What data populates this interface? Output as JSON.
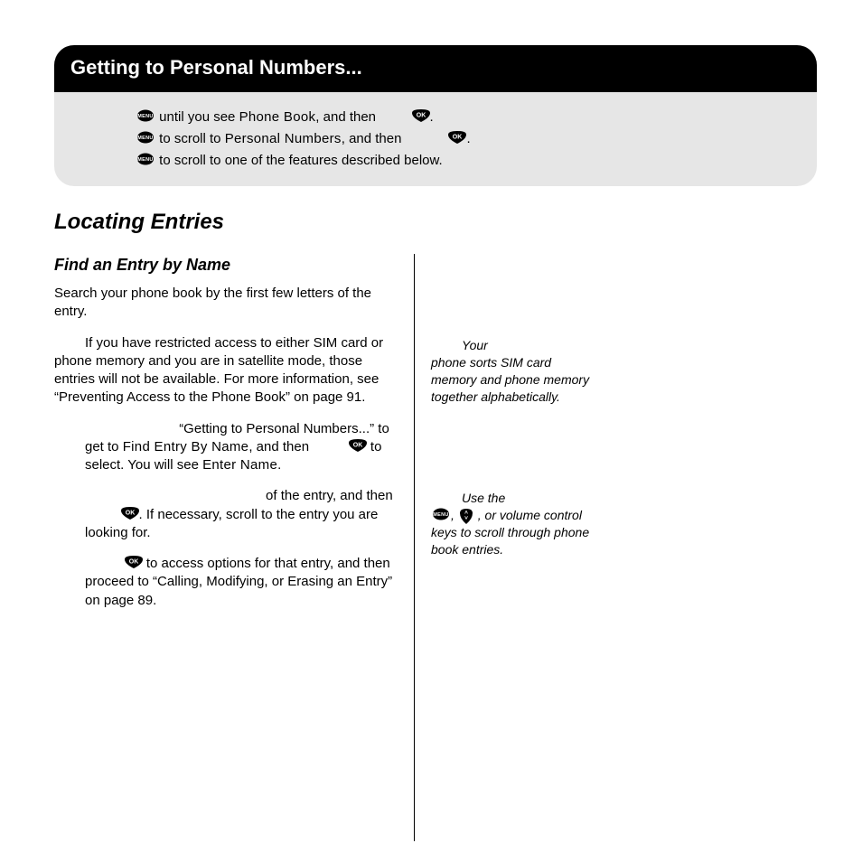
{
  "header": {
    "title": "Getting to Personal Numbers...",
    "steps": {
      "s1a": " until you see ",
      "s1b": "Phone Book",
      "s1c": ", and then ",
      "s1d": ".",
      "s2a": " to scroll to ",
      "s2b": "Personal Numbers",
      "s2c": ", and then ",
      "s2d": ".",
      "s3a": " to scroll to one of the features described below."
    }
  },
  "section_heading": "Locating Entries",
  "sub_heading": "Find an Entry by Name",
  "p_intro": "Search your phone book by the first few letters of the entry.",
  "p_note": "If you have restricted access to either SIM card or phone memory and you are in satellite mode, those entries will not be available. For more information, see “Preventing Access to the Phone Book” on page 91.",
  "p_step1": {
    "a": "“Getting to Personal Numbers...” to get to ",
    "lcd1": "Find Entry By Name",
    "b": ", and then ",
    "c": " to select. You will see ",
    "lcd2": "Enter Name",
    "d": "."
  },
  "p_step2": {
    "a": " of the entry, and then ",
    "b": ". If necessary, scroll to the entry you are looking for."
  },
  "p_step3": {
    "a": " to access options for that entry, and then proceed to “Calling, Modifying, or Erasing an Entry” on page 89."
  },
  "tip1": {
    "a": "Your",
    "b": "phone sorts SIM card memory and phone memory together alphabetically."
  },
  "tip2": {
    "a": "Use the",
    "b": ", ",
    "c": ", or volume control keys to scroll through phone book entries."
  }
}
